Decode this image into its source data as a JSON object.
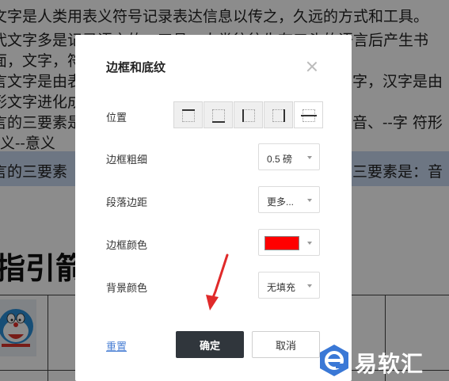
{
  "document": {
    "lines": [
      "文字是人类用表义符号记录表达信息以传之，久远的方式和工具。",
      "代文字多是记录语言的。工具。人类往往先有口头的语言后产生书",
      "面，文字，符",
      "言文字是由表",
      "形文字进化成",
      "言的三要素是",
      " 义--意义",
      "言的三要素"
    ],
    "right_lines": [
      "",
      "",
      "字，汉字是由",
      "",
      "音、--字 符形",
      "三要素是：音"
    ],
    "heading": "指引箭"
  },
  "dialog": {
    "title": "边框和底纹",
    "rows": {
      "position_label": "位置",
      "width_label": "边框粗细",
      "width_value": "0.5 磅",
      "spacing_label": "段落边距",
      "spacing_value": "更多...",
      "color_label": "边框颜色",
      "color_value": "#ff0000",
      "bg_label": "背景颜色",
      "bg_value": "无填充"
    },
    "position_options": [
      "top-border",
      "bottom-border",
      "left-border",
      "right-border",
      "inner-horizontal-border"
    ],
    "reset_label": "重置",
    "ok_label": "确定",
    "cancel_label": "取消"
  },
  "watermark": {
    "text": "易软汇",
    "logo": "e-logo-icon"
  },
  "colors": {
    "accent": "#30363c",
    "link": "#4a7fd4",
    "highlight": "#c6d7ee",
    "annotation_arrow": "#e02a2a",
    "brand": "#3a78d6"
  }
}
